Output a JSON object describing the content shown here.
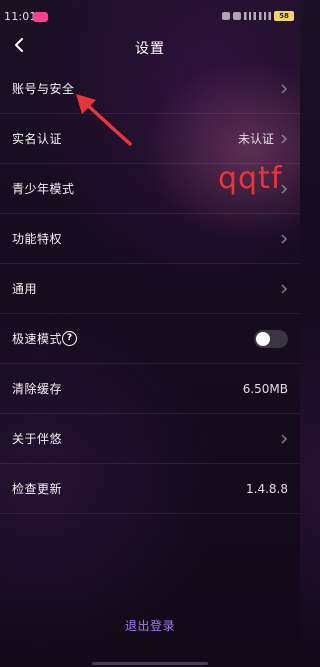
{
  "status_bar": {
    "time": "11:01",
    "battery": "58"
  },
  "header": {
    "title": "设置"
  },
  "rows": [
    {
      "label": "账号与安全"
    },
    {
      "label": "实名认证",
      "value": "未认证"
    },
    {
      "label": "青少年模式"
    },
    {
      "label": "功能特权"
    },
    {
      "label": "通用"
    },
    {
      "label": "极速模式"
    },
    {
      "label": "清除缓存",
      "value": "6.50MB"
    },
    {
      "label": "关于伴悠"
    },
    {
      "label": "检查更新",
      "value": "1.4.8.8"
    }
  ],
  "toggle": {
    "on": false
  },
  "watermark": "qqtf",
  "logout_label": "退出登录",
  "colors": {
    "accent": "#a07af0",
    "watermark": "#e8353a",
    "arrow": "#e8363b"
  }
}
